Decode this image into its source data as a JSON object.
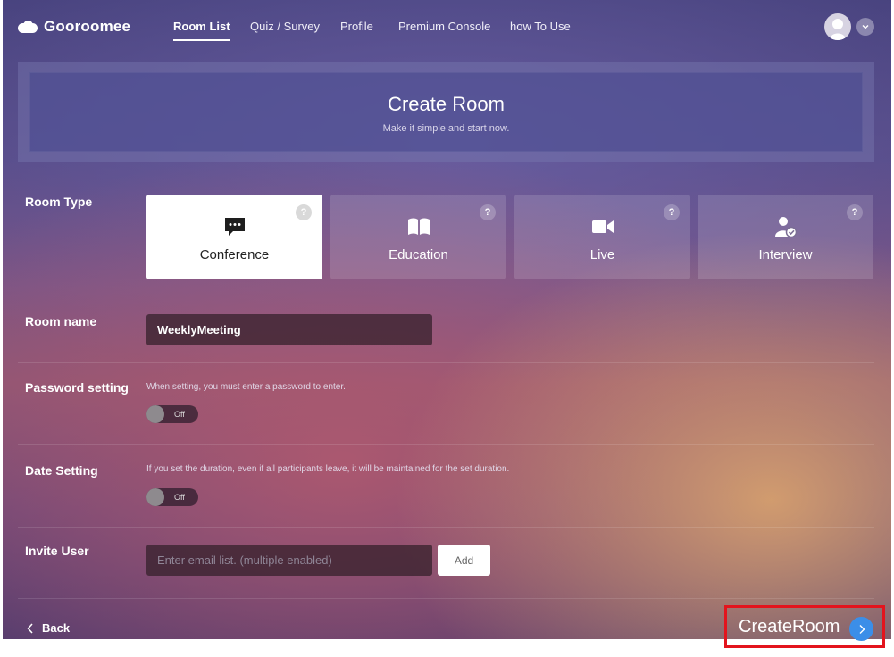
{
  "nav": {
    "brand": "Gooroomee",
    "items": [
      {
        "label": "Room List",
        "active": true
      },
      {
        "label": "Quiz / Survey",
        "active": false
      },
      {
        "label": "Profile",
        "active": false
      },
      {
        "label": "Premium Console",
        "active": false
      },
      {
        "label": "how To Use",
        "active": false
      }
    ]
  },
  "banner": {
    "title": "Create Room",
    "subtitle": "Make it simple and start now."
  },
  "room_type": {
    "label": "Room Type",
    "selected": "Conference",
    "options": [
      {
        "label": "Conference",
        "icon": "chat-bubble-icon",
        "help": "?"
      },
      {
        "label": "Education",
        "icon": "open-book-icon",
        "help": "?"
      },
      {
        "label": "Live",
        "icon": "video-camera-icon",
        "help": "?"
      },
      {
        "label": "Interview",
        "icon": "user-check-icon",
        "help": "?"
      }
    ]
  },
  "room_name": {
    "label": "Room name",
    "value": "WeeklyMeeting"
  },
  "password": {
    "label": "Password setting",
    "hint": "When setting, you must enter a password to enter.",
    "toggle": "Off"
  },
  "date": {
    "label": "Date Setting",
    "hint": "If you set the duration, even if all participants leave, it will be maintained for the set duration.",
    "toggle": "Off"
  },
  "invite": {
    "label": "Invite User",
    "placeholder": "Enter email list. (multiple enabled)",
    "add_label": "Add"
  },
  "footer": {
    "back_label": "Back",
    "create_label": "CreateRoom"
  },
  "colors": {
    "create_highlight": "#e3141d",
    "create_arrow": "#3b8ee8"
  }
}
